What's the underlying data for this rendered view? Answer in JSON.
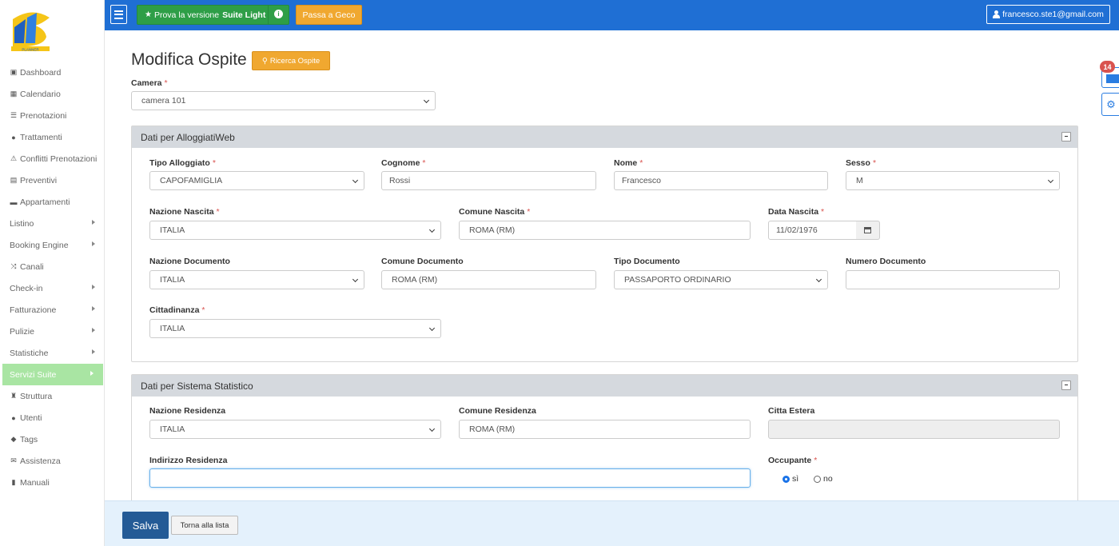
{
  "brand": {
    "logo_text": "PLANNER"
  },
  "sidebar": {
    "items": [
      {
        "label": "Dashboard",
        "icon": "dashboard-icon",
        "glyph": "▣"
      },
      {
        "label": "Calendario",
        "icon": "calendar-icon",
        "glyph": "▦"
      },
      {
        "label": "Prenotazioni",
        "icon": "list-icon",
        "glyph": "☰"
      },
      {
        "label": "Trattamenti",
        "icon": "apple-icon",
        "glyph": "●"
      },
      {
        "label": "Conflitti Prenotazioni",
        "icon": "warning-icon",
        "glyph": "⚠"
      },
      {
        "label": "Preventivi",
        "icon": "document-icon",
        "glyph": "▤"
      },
      {
        "label": "Appartamenti",
        "icon": "bed-icon",
        "glyph": "▬"
      },
      {
        "label": "Listino",
        "submenu": true
      },
      {
        "label": "Booking Engine",
        "submenu": true
      },
      {
        "label": "Canali",
        "icon": "shuffle-icon",
        "glyph": "⤨"
      },
      {
        "label": "Check-in",
        "submenu": true
      },
      {
        "label": "Fatturazione",
        "submenu": true
      },
      {
        "label": "Pulizie",
        "submenu": true
      },
      {
        "label": "Statistiche",
        "submenu": true
      },
      {
        "label": "Servizi Suite",
        "submenu": true,
        "active": true
      },
      {
        "label": "Struttura",
        "icon": "building-icon",
        "glyph": "♜"
      },
      {
        "label": "Utenti",
        "icon": "user-icon",
        "glyph": "●"
      },
      {
        "label": "Tags",
        "icon": "tags-icon",
        "glyph": "◆"
      },
      {
        "label": "Assistenza",
        "icon": "envelope-icon",
        "glyph": "✉"
      },
      {
        "label": "Manuali",
        "icon": "book-icon",
        "glyph": "▮"
      }
    ]
  },
  "topbar": {
    "suite_prefix": "Prova la versione",
    "suite_strong": "Suite Light",
    "geco": "Passa a Geco",
    "user": "francesco.ste1@gmail.com"
  },
  "notifications": {
    "count": "14"
  },
  "page": {
    "title": "Modifica Ospite",
    "search_button": "Ricerca Ospite",
    "camera_label": "Camera",
    "camera_value": "camera 101"
  },
  "alloggiati": {
    "title": "Dati per AlloggiatiWeb",
    "tipo_alloggiato": {
      "label": "Tipo Alloggiato",
      "value": "CAPOFAMIGLIA"
    },
    "cognome": {
      "label": "Cognome",
      "value": "Rossi"
    },
    "nome": {
      "label": "Nome",
      "value": "Francesco"
    },
    "sesso": {
      "label": "Sesso",
      "value": "M"
    },
    "nazione_nascita": {
      "label": "Nazione Nascita",
      "value": "ITALIA"
    },
    "comune_nascita": {
      "label": "Comune Nascita",
      "value": "ROMA (RM)"
    },
    "data_nascita": {
      "label": "Data Nascita",
      "value": "11/02/1976"
    },
    "nazione_documento": {
      "label": "Nazione Documento",
      "value": "ITALIA"
    },
    "comune_documento": {
      "label": "Comune Documento",
      "value": "ROMA (RM)"
    },
    "tipo_documento": {
      "label": "Tipo Documento",
      "value": "PASSAPORTO ORDINARIO"
    },
    "numero_documento": {
      "label": "Numero Documento",
      "value": ""
    },
    "cittadinanza": {
      "label": "Cittadinanza",
      "value": "ITALIA"
    }
  },
  "statistico": {
    "title": "Dati per Sistema Statistico",
    "nazione_residenza": {
      "label": "Nazione Residenza",
      "value": "ITALIA"
    },
    "comune_residenza": {
      "label": "Comune Residenza",
      "value": "ROMA (RM)"
    },
    "citta_estera": {
      "label": "Citta Estera",
      "value": ""
    },
    "indirizzo_residenza": {
      "label": "Indirizzo Residenza",
      "value": ""
    },
    "occupante": {
      "label": "Occupante",
      "yes": "sì",
      "no": "no",
      "selected": "sì"
    }
  },
  "footer": {
    "save": "Salva",
    "back": "Torna alla lista"
  },
  "colors": {
    "topbar": "#1f6fd4",
    "accent_orange": "#f0a830",
    "success_green": "#2e9e47",
    "active_nav": "#a9e5a3",
    "save_blue": "#245b96"
  }
}
